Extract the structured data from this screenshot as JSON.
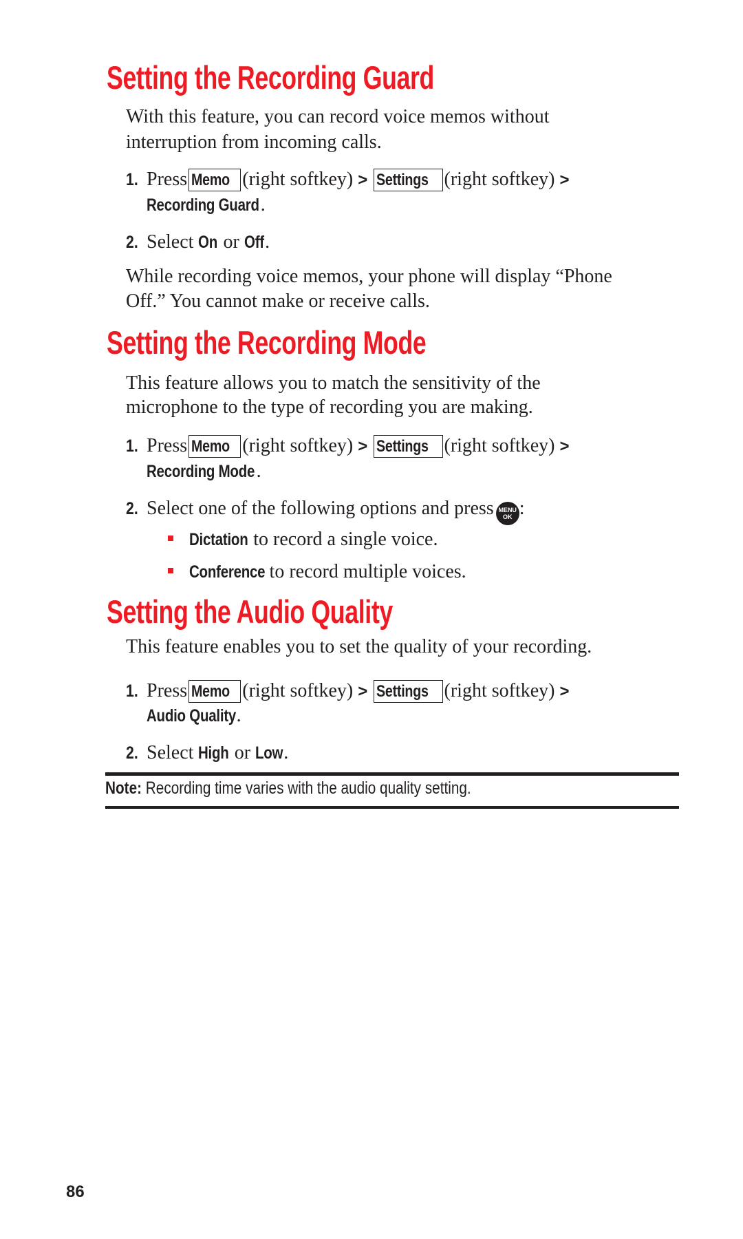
{
  "sections": [
    {
      "heading": "Setting the Recording Guard",
      "intro": [
        "With this feature, you can record voice memos without",
        "interruption from incoming calls."
      ],
      "step1": {
        "num": "1.",
        "press": "Press",
        "key1": "Memo",
        "softkey1": "(right softkey)",
        "gt1": ">",
        "key2": "Settings",
        "softkey2": "(right softkey)",
        "gt2": ">",
        "target": "Recording Guard",
        "period": "."
      },
      "step2": {
        "num": "2.",
        "select": "Select",
        "opt1": "On",
        "or": "or",
        "opt2": "Off",
        "period": "."
      },
      "outro": [
        "While recording voice memos, your phone will display “Phone",
        "Off.”  You cannot make or receive calls."
      ]
    },
    {
      "heading": "Setting the Recording Mode",
      "intro": [
        "This feature allows you to match the sensitivity of the",
        "microphone to the type of recording you are making."
      ],
      "step1": {
        "num": "1.",
        "press": "Press",
        "key1": "Memo",
        "softkey1": "(right softkey)",
        "gt1": ">",
        "key2": "Settings",
        "softkey2": "(right softkey)",
        "gt2": ">",
        "target": "Recording Mode",
        "period": "."
      },
      "step2": {
        "num": "2.",
        "text": "Select one of the following options and press",
        "button_icon": "menu-ok-button-icon",
        "button_line1": "MENU",
        "button_line2": "OK",
        "colon": ":"
      },
      "options": [
        {
          "label": "Dictation",
          "desc": "to record a single voice."
        },
        {
          "label": "Conference",
          "desc": "to record multiple voices."
        }
      ]
    },
    {
      "heading": "Setting the Audio Quality",
      "intro": [
        "This feature enables you to set the quality of your recording."
      ],
      "step1": {
        "num": "1.",
        "press": "Press",
        "key1": "Memo",
        "softkey1": "(right softkey)",
        "gt1": ">",
        "key2": "Settings",
        "softkey2": "(right softkey)",
        "gt2": ">",
        "target": "Audio Quality",
        "period": "."
      },
      "step2": {
        "num": "2.",
        "select": "Select",
        "opt1": "High",
        "or": "or",
        "opt2": "Low",
        "period": "."
      }
    }
  ],
  "note": {
    "label": "Note:",
    "text": "Recording time varies with the audio quality setting."
  },
  "page_number": "86",
  "colors": {
    "accent_red": "#ed1c24",
    "text": "#231f20"
  }
}
